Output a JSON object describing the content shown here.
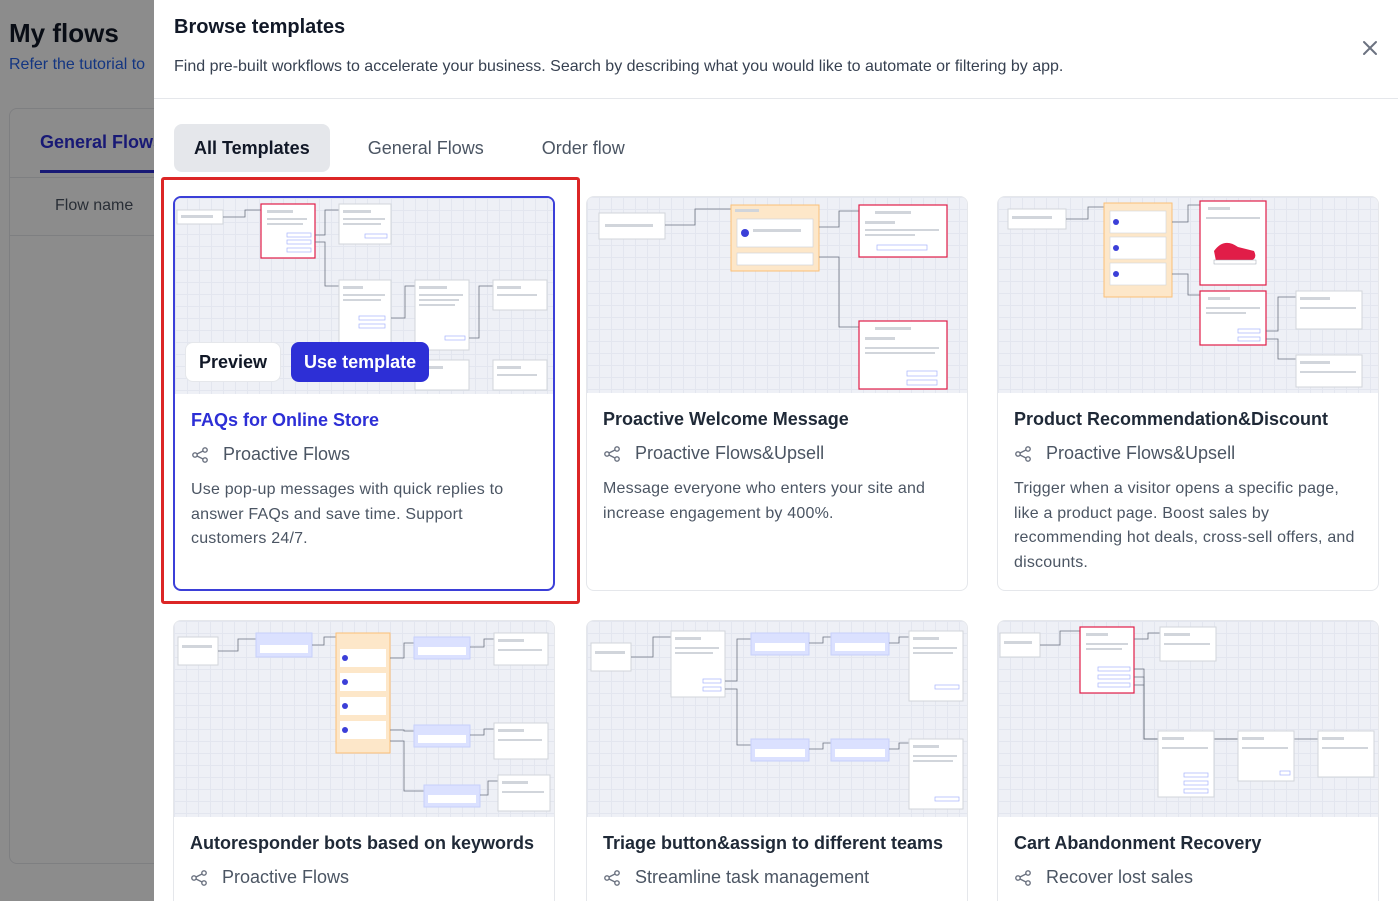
{
  "background": {
    "title": "My flows",
    "tutorial_text": "Refer the tutorial to",
    "tab_label": "General Flows",
    "column_header": "Flow name"
  },
  "modal": {
    "title": "Browse templates",
    "subtitle": "Find pre-built workflows to accelerate your business. Search by describing what you would like to automate or filtering by app.",
    "tabs": [
      {
        "label": "All Templates",
        "active": true
      },
      {
        "label": "General Flows",
        "active": false
      },
      {
        "label": "Order flow",
        "active": false
      }
    ],
    "hover_actions": {
      "preview_label": "Preview",
      "use_label": "Use template"
    },
    "cards": [
      {
        "title": "FAQs for Online Store",
        "category": "Proactive Flows",
        "description": "Use pop-up messages with quick replies to answer FAQs and save time. Support customers 24/7."
      },
      {
        "title": "Proactive Welcome Message",
        "category": "Proactive Flows&Upsell",
        "description": "Message everyone who enters your site and increase engagement by 400%."
      },
      {
        "title": "Product Recommendation&Discount",
        "category": "Proactive Flows&Upsell",
        "description": "Trigger when a visitor opens a specific page, like a product page. Boost sales by recommending hot deals, cross-sell offers, and discounts."
      },
      {
        "title": "Autoresponder bots based on keywords",
        "category": "Proactive Flows",
        "description": ""
      },
      {
        "title": "Triage button&assign to different teams",
        "category": "Streamline task management",
        "description": ""
      },
      {
        "title": "Cart Abandonment Recovery",
        "category": "Recover lost sales",
        "description": ""
      }
    ]
  },
  "colors": {
    "accent": "#2d2fd6",
    "highlight": "#dc2626",
    "overlay": "rgba(0,0,0,0.45)"
  }
}
